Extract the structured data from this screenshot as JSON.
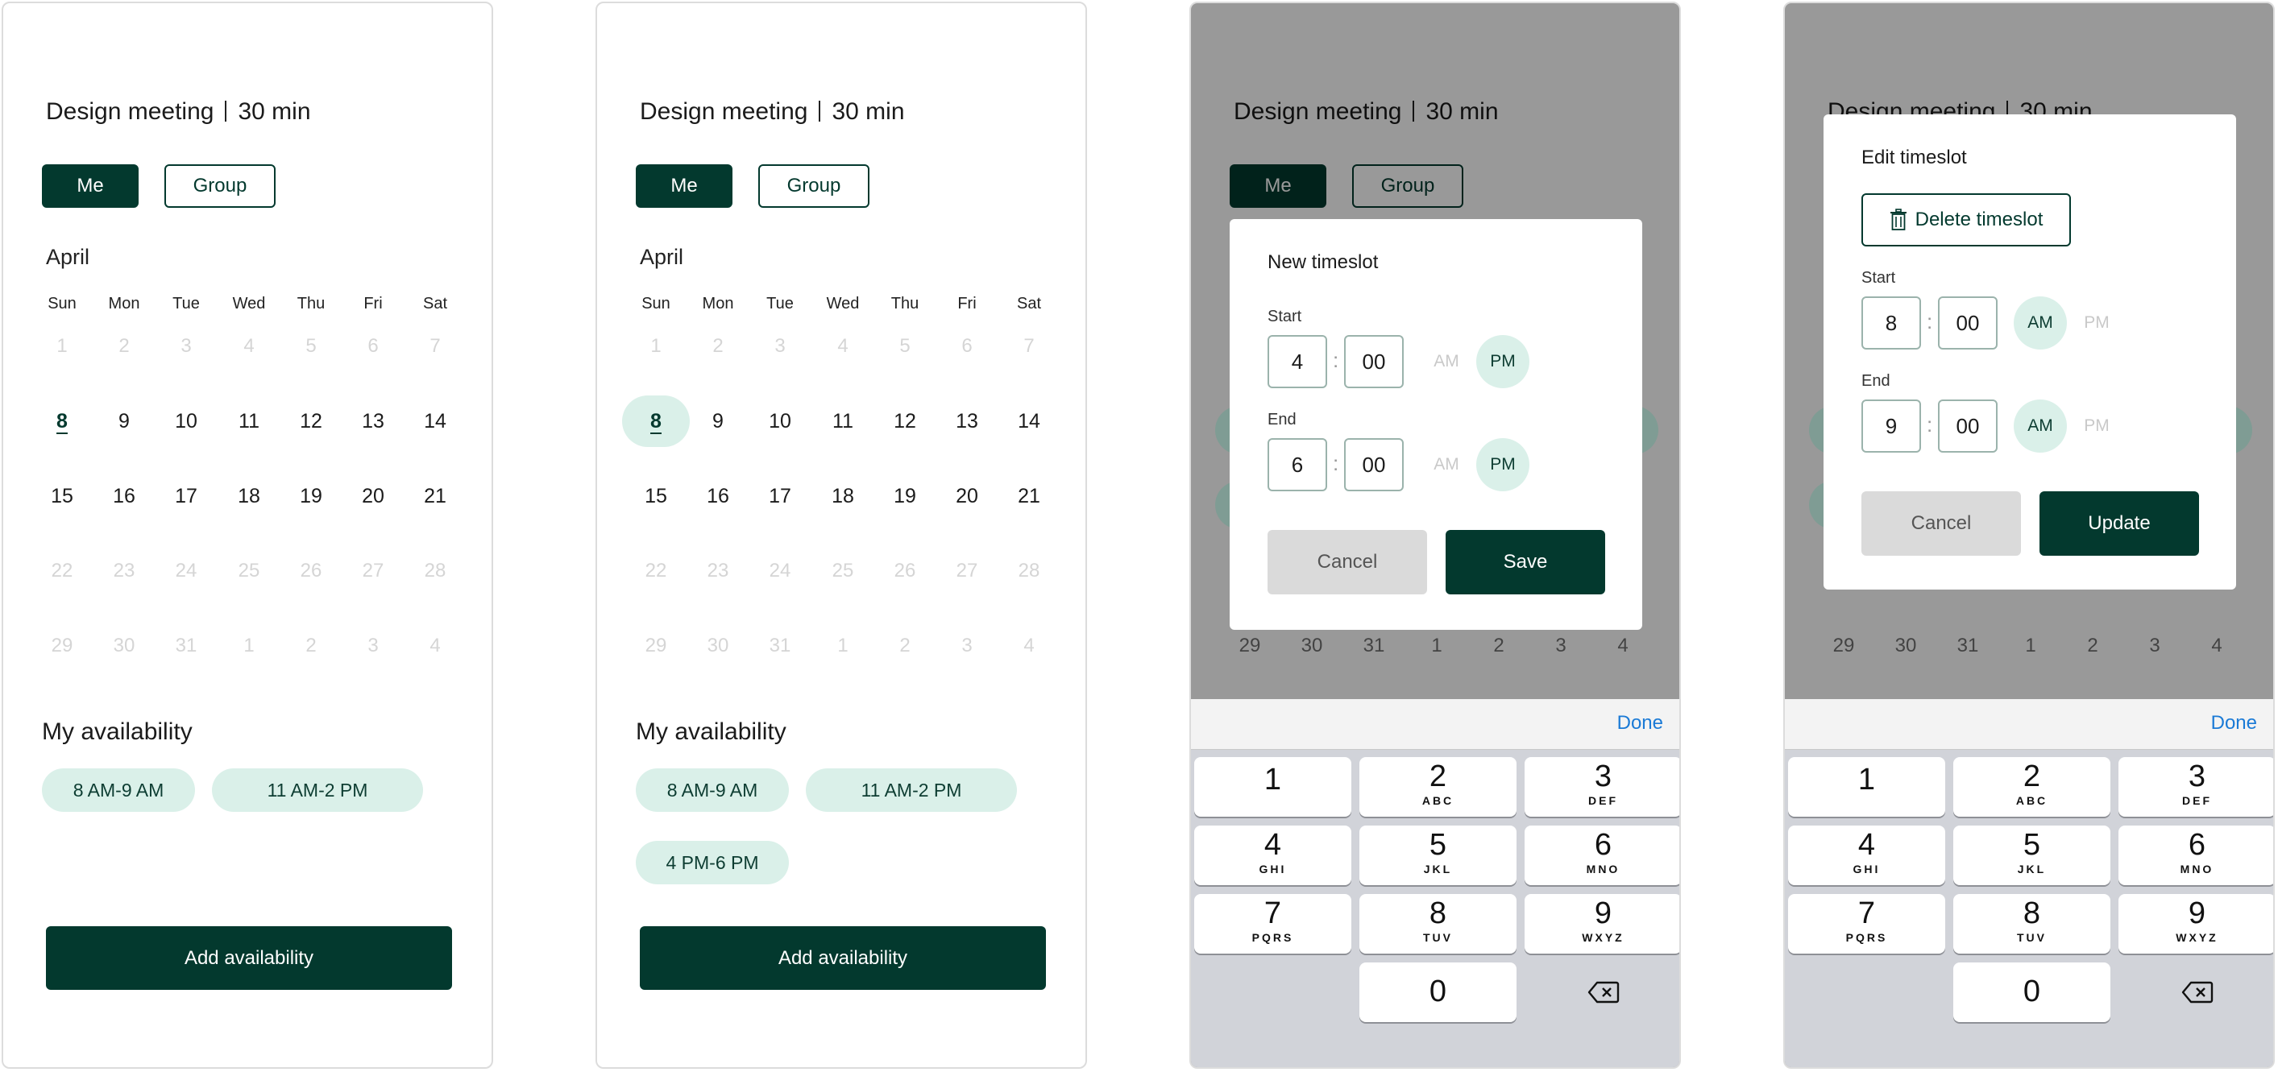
{
  "meeting": {
    "name": "Design meeting",
    "duration": "30 min"
  },
  "segments": {
    "me": "Me",
    "group": "Group"
  },
  "calendar": {
    "month": "April",
    "weekdays": [
      "Sun",
      "Mon",
      "Tue",
      "Wed",
      "Thu",
      "Fri",
      "Sat"
    ],
    "weeks": [
      [
        "1",
        "2",
        "3",
        "4",
        "5",
        "6",
        "7"
      ],
      [
        "8",
        "9",
        "10",
        "11",
        "12",
        "13",
        "14"
      ],
      [
        "15",
        "16",
        "17",
        "18",
        "19",
        "20",
        "21"
      ],
      [
        "22",
        "23",
        "24",
        "25",
        "26",
        "27",
        "28"
      ],
      [
        "29",
        "30",
        "31",
        "1",
        "2",
        "3",
        "4"
      ]
    ]
  },
  "availability": {
    "heading": "My availability",
    "slots": [
      "8 AM-9 AM",
      "11 AM-2 PM",
      "4 PM-6 PM"
    ],
    "add_label": "Add availability"
  },
  "new_timeslot": {
    "title": "New timeslot",
    "start_label": "Start",
    "start_hour": "4",
    "start_min": "00",
    "start_period": "PM",
    "end_label": "End",
    "end_hour": "6",
    "end_min": "00",
    "end_period": "PM",
    "am": "AM",
    "pm": "PM",
    "cancel": "Cancel",
    "save": "Save"
  },
  "edit_timeslot": {
    "title": "Edit timeslot",
    "delete": "Delete timeslot",
    "start_label": "Start",
    "start_hour": "8",
    "start_min": "00",
    "start_period": "AM",
    "end_label": "End",
    "end_hour": "9",
    "end_min": "00",
    "end_period": "AM",
    "am": "AM",
    "pm": "PM",
    "cancel": "Cancel",
    "update": "Update"
  },
  "keyboard": {
    "done": "Done",
    "keys": [
      {
        "n": "1",
        "l": ""
      },
      {
        "n": "2",
        "l": "ABC"
      },
      {
        "n": "3",
        "l": "DEF"
      },
      {
        "n": "4",
        "l": "GHI"
      },
      {
        "n": "5",
        "l": "JKL"
      },
      {
        "n": "6",
        "l": "MNO"
      },
      {
        "n": "7",
        "l": "PQRS"
      },
      {
        "n": "8",
        "l": "TUV"
      },
      {
        "n": "9",
        "l": "WXYZ"
      }
    ],
    "zero": "0"
  },
  "colors": {
    "primary": "#03392e",
    "chip": "#daf0e9",
    "link": "#1a7ad6"
  }
}
